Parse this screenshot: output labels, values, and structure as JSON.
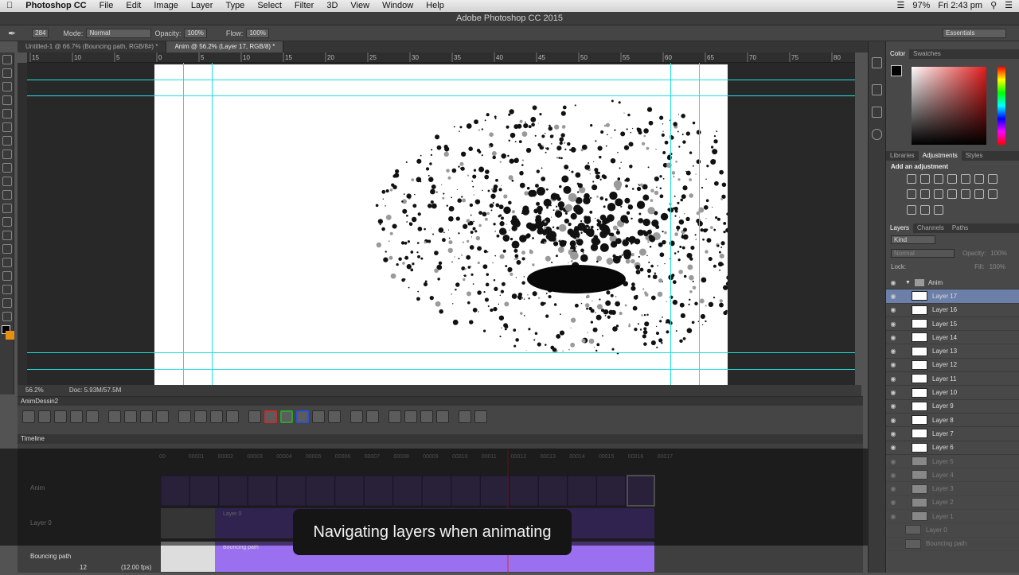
{
  "menubar": {
    "apple": "",
    "app": "Photoshop CC",
    "items": [
      "File",
      "Edit",
      "Image",
      "Layer",
      "Type",
      "Select",
      "Filter",
      "3D",
      "View",
      "Window",
      "Help"
    ],
    "battery": "97%",
    "clock": "Fri 2:43 pm"
  },
  "window": {
    "title": "Adobe Photoshop CC 2015"
  },
  "options": {
    "brush_size": "284",
    "mode_label": "Mode:",
    "mode_value": "Normal",
    "opacity_label": "Opacity:",
    "opacity_value": "100%",
    "flow_label": "Flow:",
    "flow_value": "100%",
    "workspace": "Essentials"
  },
  "tabs": [
    {
      "label": "Untitled-1 @ 66.7% (Bouncing path, RGB/8#) *"
    },
    {
      "label": "Anim @ 56.2% (Layer 17, RGB/8) *"
    }
  ],
  "ruler": {
    "h_ticks": [
      "15",
      "10",
      "5",
      "0",
      "5",
      "10",
      "15",
      "20",
      "25",
      "30",
      "35",
      "40",
      "45",
      "50",
      "55",
      "60",
      "65",
      "70",
      "75",
      "80"
    ]
  },
  "status": {
    "zoom": "56.2%",
    "doc": "Doc: 5.93M/57.5M"
  },
  "animdessin": {
    "title": "AnimDessin2"
  },
  "timeline": {
    "title": "Timeline",
    "frames": [
      "00",
      "00001",
      "00002",
      "00003",
      "00004",
      "00005",
      "00006",
      "00007",
      "00008",
      "00009",
      "00010",
      "00011",
      "00012",
      "00013",
      "00014",
      "00015",
      "00016",
      "00017"
    ],
    "tracks": [
      {
        "name": "Anim"
      },
      {
        "name": "Layer 0"
      },
      {
        "name": "Bouncing path"
      }
    ],
    "clips": [
      "Layer 0",
      "Bouncing path"
    ],
    "frame_num": "12",
    "fps": "(12.00 fps)"
  },
  "caption": "Navigating layers when animating",
  "panels": {
    "color_tabs": [
      "Color",
      "Swatches"
    ],
    "adj_tabs": [
      "Libraries",
      "Adjustments",
      "Styles"
    ],
    "adj_title": "Add an adjustment",
    "layer_tabs": [
      "Layers",
      "Channels",
      "Paths"
    ],
    "kind": "Kind",
    "blend": "Normal",
    "opacity_label": "Opacity:",
    "opacity_value": "100%",
    "lock_label": "Lock:",
    "fill_label": "Fill:",
    "fill_value": "100%"
  },
  "layers": {
    "group": "Anim",
    "items": [
      "Layer 17",
      "Layer 16",
      "Layer 15",
      "Layer 14",
      "Layer 13",
      "Layer 12",
      "Layer 11",
      "Layer 10",
      "Layer 9",
      "Layer 8",
      "Layer 7",
      "Layer 6",
      "Layer 5",
      "Layer 4",
      "Layer 3",
      "Layer 2",
      "Layer 1"
    ],
    "bottom": [
      "Layer 0",
      "Bouncing path"
    ],
    "selected_index": 0
  }
}
